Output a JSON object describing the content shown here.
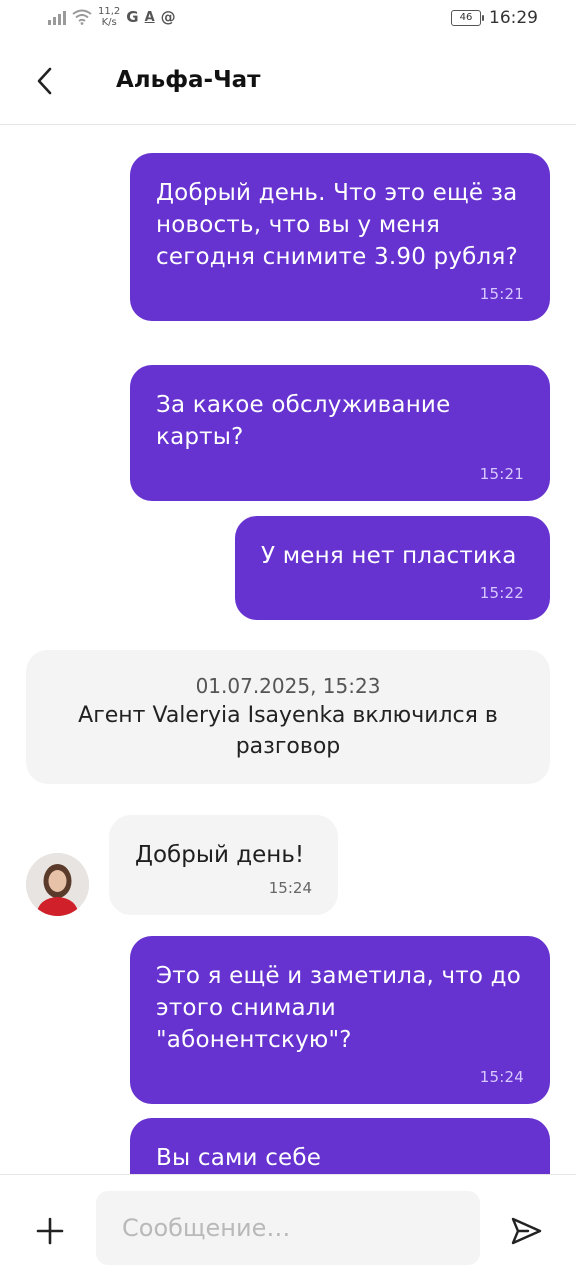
{
  "status_bar": {
    "net_speed_value": "11,2",
    "net_speed_unit": "K/s",
    "notif_icons": [
      "G",
      "A",
      "@"
    ],
    "battery_level": "46",
    "time": "16:29"
  },
  "header": {
    "title": "Альфа-Чат"
  },
  "messages": [
    {
      "from": "user",
      "text": "Добрый день. Что это ещё за новость, что вы у меня сегодня снимите 3.90 рубля?",
      "time": "15:21"
    },
    {
      "from": "user",
      "text": "За какое обслуживание карты?",
      "time": "15:21"
    },
    {
      "from": "user",
      "text": "У меня нет пластика",
      "time": "15:22"
    },
    {
      "from": "system",
      "date": "01.07.2025, 15:23",
      "text": "Агент Valeryia Isayenka включился в разговор"
    },
    {
      "from": "agent",
      "text": "Добрый день!",
      "time": "15:24"
    },
    {
      "from": "user",
      "text": "Это я ещё и заметила, что до этого снимали \"абонентскую\"?",
      "time": "15:24"
    },
    {
      "from": "user",
      "text": "Вы сами себе"
    }
  ],
  "composer": {
    "placeholder": "Сообщение…"
  },
  "colors": {
    "outgoing_bubble": "#6632d0",
    "incoming_bubble": "#f4f4f4"
  },
  "icons": {
    "back": "chevron-left-icon",
    "attach": "plus-icon",
    "send": "send-icon"
  }
}
